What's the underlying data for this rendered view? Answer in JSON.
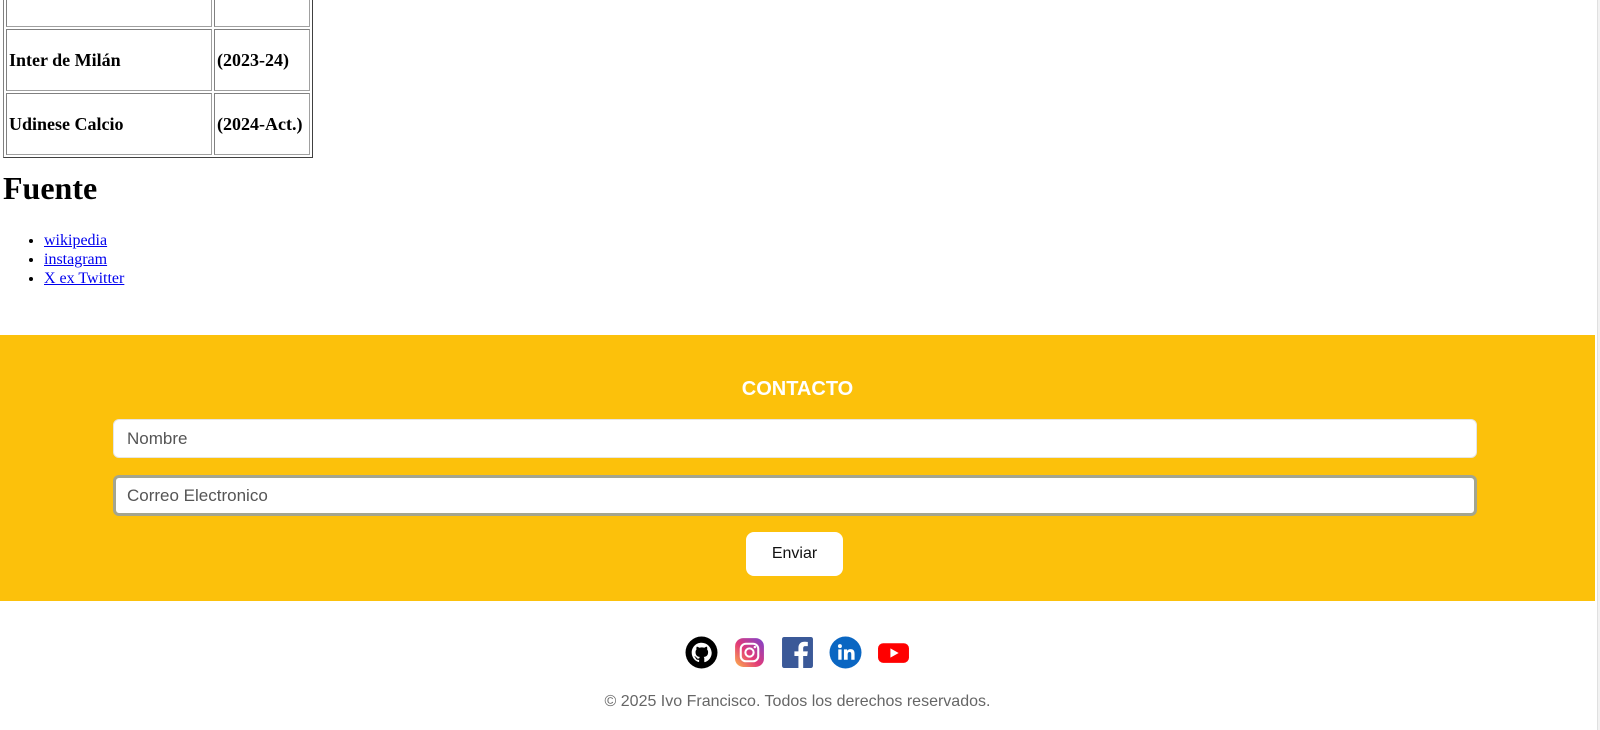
{
  "clubs_table": {
    "rows": [
      {
        "club": "",
        "years": ""
      },
      {
        "club": "Inter de Milán",
        "years": "(2023-24)"
      },
      {
        "club": "Udinese Calcio",
        "years": "(2024-Act.)"
      }
    ]
  },
  "fuente": {
    "heading": "Fuente",
    "links": [
      {
        "label": "wikipedia"
      },
      {
        "label": "instagram"
      },
      {
        "label": "X ex Twitter"
      }
    ]
  },
  "contact": {
    "title": "CONTACTO",
    "name_placeholder": "Nombre",
    "email_placeholder": "Correo Electronico",
    "send_label": "Enviar",
    "background_color": "#fcc10b"
  },
  "footer": {
    "social": [
      {
        "icon": "github-icon"
      },
      {
        "icon": "instagram-icon"
      },
      {
        "icon": "facebook-icon"
      },
      {
        "icon": "linkedin-icon"
      },
      {
        "icon": "youtube-icon"
      }
    ],
    "copyright": "© 2025 Ivo Francisco. Todos los derechos reservados."
  }
}
